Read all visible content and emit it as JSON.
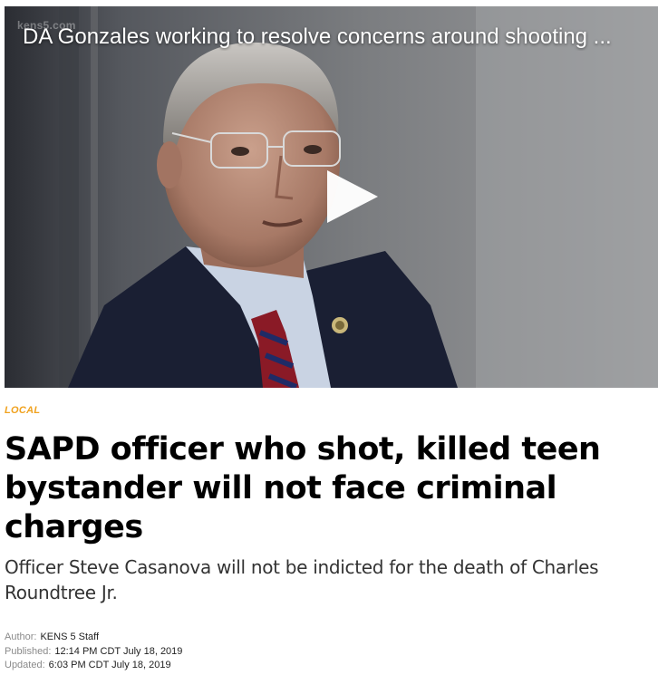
{
  "video": {
    "title": "DA Gonzales working to resolve concerns around shooting ...",
    "watermark": "kens5.com",
    "play_icon": "play-icon"
  },
  "article": {
    "section": "LOCAL",
    "headline": "SAPD officer who shot, killed teen bystander will not face criminal charges",
    "subheadline": "Officer Steve Casanova will not be indicted for the death of Charles Roundtree Jr.",
    "author_label": "Author:",
    "author": "KENS 5 Staff",
    "published_label": "Published:",
    "published": "12:14 PM CDT July 18, 2019",
    "updated_label": "Updated:",
    "updated": "6:03 PM CDT July 18, 2019"
  },
  "colors": {
    "section_accent": "#f0a21f",
    "headline": "#000000",
    "subheadline": "#333333",
    "meta_label": "#8a8a8a"
  }
}
